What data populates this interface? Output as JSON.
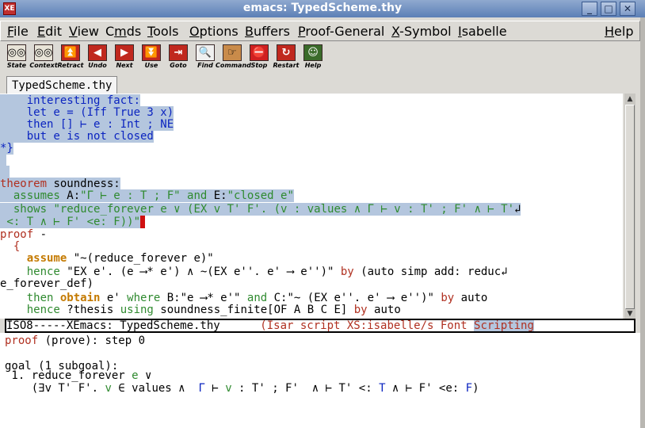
{
  "window": {
    "title": "emacs: TypedScheme.thy",
    "app_icon": "XE",
    "minimize": "_",
    "maximize": "□",
    "close": "✕"
  },
  "menubar": [
    {
      "pre": "",
      "mn": "F",
      "post": "ile"
    },
    {
      "pre": "",
      "mn": "E",
      "post": "dit"
    },
    {
      "pre": "",
      "mn": "V",
      "post": "iew"
    },
    {
      "pre": "C",
      "mn": "m",
      "post": "ds"
    },
    {
      "pre": "",
      "mn": "T",
      "post": "ools"
    },
    {
      "pre": "",
      "mn": "O",
      "post": "ptions"
    },
    {
      "pre": "",
      "mn": "B",
      "post": "uffers"
    },
    {
      "pre": "",
      "mn": "P",
      "post": "roof-General"
    },
    {
      "pre": "",
      "mn": "X",
      "post": "-Symbol"
    },
    {
      "pre": "",
      "mn": "I",
      "post": "sabelle"
    },
    {
      "pre": "",
      "mn": "H",
      "post": "elp"
    }
  ],
  "toolbar": [
    {
      "label": "State",
      "glyph": "◎◎",
      "icon": "eyes-icon",
      "bg": "#e8e4d8",
      "fg": "#000"
    },
    {
      "label": "Context",
      "glyph": "◎◎",
      "icon": "eyes-context-icon",
      "bg": "#e8e4d8",
      "fg": "#000"
    },
    {
      "label": "Retract",
      "glyph": "⏫",
      "icon": "retract-icon",
      "bg": "#c0281e",
      "fg": "#fff"
    },
    {
      "label": "Undo",
      "glyph": "◀",
      "icon": "undo-icon",
      "bg": "#c0281e",
      "fg": "#fff"
    },
    {
      "label": "Next",
      "glyph": "▶",
      "icon": "next-icon",
      "bg": "#c0281e",
      "fg": "#fff"
    },
    {
      "label": "Use",
      "glyph": "⏬",
      "icon": "use-icon",
      "bg": "#c0281e",
      "fg": "#fff"
    },
    {
      "label": "Goto",
      "glyph": "⇥",
      "icon": "goto-icon",
      "bg": "#c0281e",
      "fg": "#fff"
    },
    {
      "label": "Find",
      "glyph": "🔍",
      "icon": "find-icon",
      "bg": "#f0f0f0",
      "fg": "#333"
    },
    {
      "label": "Command",
      "glyph": "☞",
      "icon": "command-icon",
      "bg": "#c98b4a",
      "fg": "#000"
    },
    {
      "label": "Stop",
      "glyph": "⛔",
      "icon": "stop-icon",
      "bg": "#d02020",
      "fg": "#fff"
    },
    {
      "label": "Restart",
      "glyph": "↻",
      "icon": "restart-icon",
      "bg": "#c0281e",
      "fg": "#fff"
    },
    {
      "label": "Help",
      "glyph": "☺",
      "icon": "help-icon",
      "bg": "#3a6b2a",
      "fg": "#fff"
    }
  ],
  "tab": {
    "label": "TypedScheme.thy"
  },
  "editor": {
    "lines": [
      [
        {
          "t": "    interesting fact:",
          "c": "blue"
        }
      ],
      [
        {
          "t": "    let e = (Iff True 3 x)",
          "c": "blue"
        }
      ],
      [
        {
          "t": "    then [] ⊢ e : Int ; NE",
          "c": "blue"
        }
      ],
      [
        {
          "t": "    but e is not closed",
          "c": "blue"
        }
      ],
      [
        {
          "t": "*}",
          "c": "blue"
        }
      ],
      [
        {
          "t": " ",
          "c": ""
        }
      ],
      [
        {
          "t": " ",
          "c": ""
        }
      ],
      [
        {
          "t": "theorem",
          "c": "kw-red"
        },
        {
          "t": " soundness:",
          "c": ""
        }
      ],
      [
        {
          "t": "  assumes",
          "c": "kw-green"
        },
        {
          "t": " A:",
          "c": ""
        },
        {
          "t": "\"Γ ⊢ e : T ; F\"",
          "c": "kw-green"
        },
        {
          "t": " and",
          "c": "kw-green"
        },
        {
          "t": " E:",
          "c": ""
        },
        {
          "t": "\"closed e\"",
          "c": "kw-green"
        }
      ],
      [
        {
          "t": "  shows",
          "c": "kw-green"
        },
        {
          "t": " \"reduce_forever e ∨ (EX v T' F'. (v : values ∧ Γ ⊢ v : T' ; F' ∧ ⊢ T'",
          "c": "kw-green"
        }
      ],
      [
        {
          "t": " <: T ∧ ⊢ F' <e: F))\"",
          "c": "kw-green"
        }
      ],
      [
        {
          "t": "proof",
          "c": "kw-red"
        },
        {
          "t": " -",
          "c": ""
        }
      ],
      [
        {
          "t": "  {",
          "c": "kw-red"
        }
      ],
      [
        {
          "t": "    assume",
          "c": "kw-orange"
        },
        {
          "t": " \"~(reduce_forever e)\"",
          "c": ""
        }
      ],
      [
        {
          "t": "    hence",
          "c": "kw-green"
        },
        {
          "t": " \"EX e'. (e ⟶* e') ∧ ~(EX e''. e' ⟶ e'')\" ",
          "c": ""
        },
        {
          "t": "by",
          "c": "kw-red"
        },
        {
          "t": " (auto simp add: reduc",
          "c": ""
        }
      ],
      [
        {
          "t": "e_forever_def)",
          "c": ""
        }
      ],
      [
        {
          "t": "    then",
          "c": "kw-green"
        },
        {
          "t": " obtain",
          "c": "kw-orange"
        },
        {
          "t": " e' ",
          "c": ""
        },
        {
          "t": "where",
          "c": "kw-green"
        },
        {
          "t": " B:\"e ⟶* e'\" ",
          "c": ""
        },
        {
          "t": "and",
          "c": "kw-green"
        },
        {
          "t": " C:\"~ (EX e''. e' ⟶ e'')\" ",
          "c": ""
        },
        {
          "t": "by",
          "c": "kw-red"
        },
        {
          "t": " auto",
          "c": ""
        }
      ],
      [
        {
          "t": "    hence",
          "c": "kw-green"
        },
        {
          "t": " ?thesis ",
          "c": ""
        },
        {
          "t": "using",
          "c": "kw-green"
        },
        {
          "t": " soundness_finite[OF A B C E] ",
          "c": ""
        },
        {
          "t": "by",
          "c": "kw-red"
        },
        {
          "t": " auto",
          "c": ""
        }
      ]
    ]
  },
  "modeline": {
    "left": "ISO8-----XEmacs: TypedScheme.thy      ",
    "middle": "(Isar script XS:isabelle/s Font ",
    "right": "Scripting"
  },
  "response": {
    "lines": [
      [
        {
          "t": "proof",
          "c": "kw-red"
        },
        {
          "t": " (prove): step 0",
          "c": ""
        }
      ],
      [
        {
          "t": " ",
          "c": ""
        }
      ],
      [
        {
          "t": "goal (1 subgoal):",
          "c": ""
        }
      ],
      [
        {
          "t": " 1. reduce_forever ",
          "c": ""
        },
        {
          "t": "e",
          "c": "kw-green"
        },
        {
          "t": " ∨",
          "c": ""
        }
      ],
      [
        {
          "t": "    (∃v T' F'. ",
          "c": ""
        },
        {
          "t": "v",
          "c": "kw-green"
        },
        {
          "t": " ∈ values ∧  ",
          "c": ""
        },
        {
          "t": "Γ",
          "c": "blue"
        },
        {
          "t": " ⊢ ",
          "c": ""
        },
        {
          "t": "v",
          "c": "kw-green"
        },
        {
          "t": " : T' ; F'  ∧ ⊢ T' <: ",
          "c": ""
        },
        {
          "t": "T",
          "c": "blue"
        },
        {
          "t": " ∧ ⊢ F' <e: ",
          "c": ""
        },
        {
          "t": "F",
          "c": "blue"
        },
        {
          "t": ")",
          "c": ""
        }
      ]
    ]
  }
}
